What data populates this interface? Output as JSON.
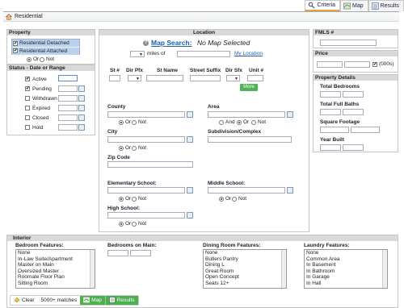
{
  "tabs": [
    {
      "label": "Criteria",
      "icon": "search-icon",
      "active": true
    },
    {
      "label": "Map",
      "icon": "map-icon",
      "active": false
    },
    {
      "label": "Results",
      "icon": "results-icon",
      "active": false
    }
  ],
  "title": "Residential",
  "property": {
    "header": "Property",
    "types": [
      {
        "label": "Residential Detached",
        "checked": true
      },
      {
        "label": "Residential Attached",
        "checked": true
      }
    ],
    "or": "Or",
    "not": "Not"
  },
  "status": {
    "header": "Status - Date or Range",
    "items": [
      {
        "label": "Active",
        "checked": true
      },
      {
        "label": "Pending",
        "checked": true
      },
      {
        "label": "Withdrawn",
        "checked": false
      },
      {
        "label": "Expired",
        "checked": false
      },
      {
        "label": "Closed",
        "checked": false
      },
      {
        "label": "Hold",
        "checked": false
      }
    ]
  },
  "location": {
    "header": "Location",
    "map_search_label": "Map Search:",
    "map_selected": "No Map Selected",
    "miles_of": "miles of",
    "my_location": "My Location",
    "address_cols": [
      "St #",
      "Dir Pfx",
      "St Name",
      "Street Suffix",
      "Dir Sfx",
      "Unit #"
    ],
    "more_button": "More",
    "county": "County",
    "area": "Area",
    "city": "City",
    "subdivision": "Subdivision/Complex",
    "zip": "Zip Code",
    "elementary": "Elementary School:",
    "middle": "Middle School:",
    "high": "High School:",
    "and": "And",
    "or": "Or",
    "not": "Not"
  },
  "fmls": {
    "header": "FMLS #"
  },
  "price": {
    "header": "Price",
    "suffix": "(000s)"
  },
  "details": {
    "header": "Property Details",
    "fields": [
      "Total Bedrooms",
      "Total Full Baths",
      "Square Footage",
      "Year Built"
    ]
  },
  "interior": {
    "header": "Interior",
    "bedroom_features": {
      "label": "Bedroom Features:",
      "options": [
        "None",
        "In-Law Suite/Apartment",
        "Master on Main",
        "Oversized Master",
        "Roomate Floor Plan",
        "Sitting Room"
      ]
    },
    "bedrooms_on_main": {
      "label": "Bedrooms on Main:"
    },
    "dining_features": {
      "label": "Dining Room Features:",
      "options": [
        "None",
        "Butlers Pantry",
        "Dining L",
        "Great Room",
        "Open Concept",
        "Seats 12+"
      ]
    },
    "laundry_features": {
      "label": "Laundry Features:",
      "options": [
        "None",
        "Common Area",
        "In Basement",
        "In Bathroom",
        "In Garage",
        "In Hall"
      ]
    }
  },
  "footer": {
    "clear": "Clear",
    "matches": "5000+ matches",
    "map": "Map",
    "results": "Results"
  }
}
